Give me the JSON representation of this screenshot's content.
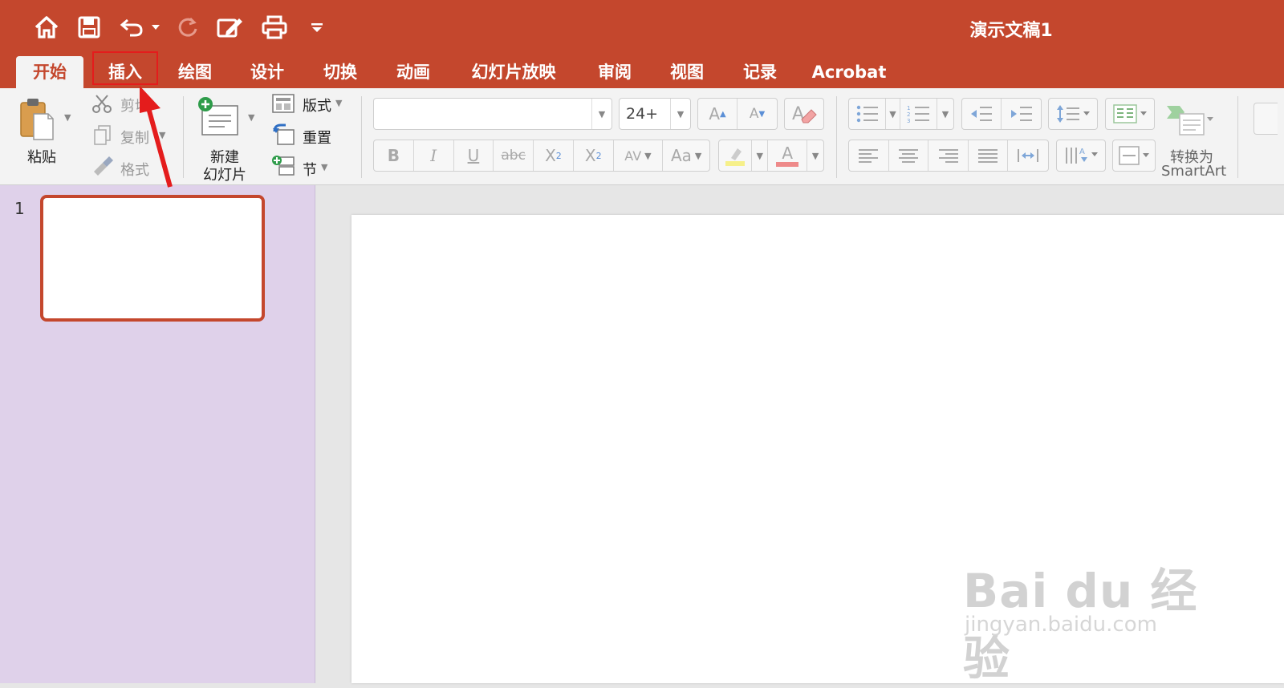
{
  "window": {
    "title": "演示文稿1"
  },
  "tabs": [
    {
      "label": "开始",
      "active": true
    },
    {
      "label": "插入",
      "active": false
    },
    {
      "label": "绘图",
      "active": false
    },
    {
      "label": "设计",
      "active": false
    },
    {
      "label": "切换",
      "active": false
    },
    {
      "label": "动画",
      "active": false
    },
    {
      "label": "幻灯片放映",
      "active": false
    },
    {
      "label": "审阅",
      "active": false
    },
    {
      "label": "视图",
      "active": false
    },
    {
      "label": "记录",
      "active": false
    },
    {
      "label": "Acrobat",
      "active": false
    }
  ],
  "quick_access": [
    "home-icon",
    "save-icon",
    "undo-icon",
    "redo-icon",
    "edit-icon",
    "print-icon",
    "customize-icon"
  ],
  "clipboard": {
    "paste": "粘贴",
    "cut": "剪切",
    "copy": "复制",
    "format": "格式"
  },
  "slides_group": {
    "new_slide_line1": "新建",
    "new_slide_line2": "幻灯片",
    "layout": "版式",
    "reset": "重置",
    "section": "节"
  },
  "font": {
    "name": "",
    "size": "24+"
  },
  "format_buttons": {
    "bold": "B",
    "italic": "I",
    "underline": "U",
    "strike": "abc",
    "superscript": "X",
    "subscript": "X",
    "spacing": "AV",
    "case": "Aa",
    "font_color": "A",
    "grow": "A",
    "shrink": "A"
  },
  "smartart": {
    "line1": "转换为",
    "line2": "SmartArt"
  },
  "slide_pane": {
    "slide_number": "1"
  },
  "watermark": {
    "main": "Bai du 经验",
    "url": "jingyan.baidu.com"
  },
  "colors": {
    "accent": "#c4472d",
    "slide_pane": "#dfd1ea",
    "highlight_box": "#e41c1c"
  }
}
